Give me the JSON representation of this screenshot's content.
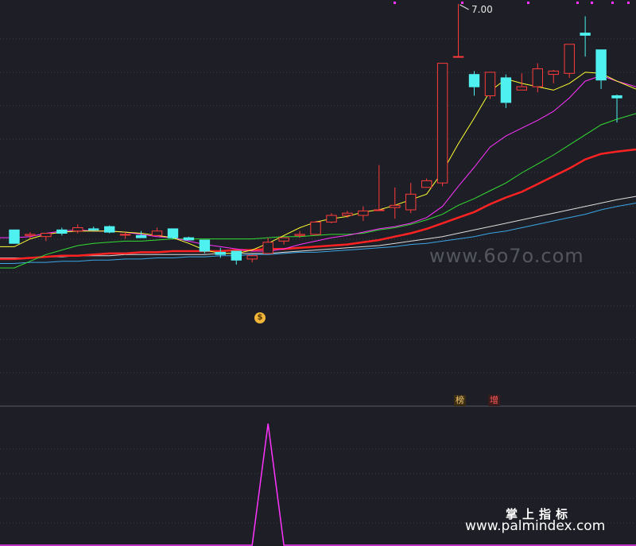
{
  "chart_data": [
    {
      "type": "candlestick",
      "title": "",
      "annotations": {
        "high_label": "7.00",
        "tags": [
          "榜",
          "增"
        ],
        "marker_icon": "moneybag-icon"
      },
      "colors": {
        "up": "#ff3b3b",
        "down": "#4ef0f0",
        "ma5": "#ffff33",
        "ma10": "#ff33ff",
        "ma20": "#33dd33",
        "ma60": "#ff2222",
        "ma120": "#dddddd",
        "ma250": "#3aa6e6",
        "grid": "#3a3f4a",
        "bg": "#1e1f26"
      },
      "ylim": [
        4.3,
        7.0
      ],
      "candles": [
        {
          "o": 4.98,
          "h": 4.98,
          "l": 4.86,
          "c": 4.86
        },
        {
          "o": 4.93,
          "h": 4.96,
          "l": 4.9,
          "c": 4.94
        },
        {
          "o": 4.92,
          "h": 4.95,
          "l": 4.88,
          "c": 4.95
        },
        {
          "o": 4.98,
          "h": 5.0,
          "l": 4.93,
          "c": 4.95
        },
        {
          "o": 4.97,
          "h": 5.03,
          "l": 4.95,
          "c": 5.0
        },
        {
          "o": 4.99,
          "h": 5.01,
          "l": 4.97,
          "c": 4.98
        },
        {
          "o": 5.01,
          "h": 5.02,
          "l": 4.95,
          "c": 4.96
        },
        {
          "o": 4.94,
          "h": 4.96,
          "l": 4.9,
          "c": 4.94
        },
        {
          "o": 4.93,
          "h": 4.97,
          "l": 4.92,
          "c": 4.91
        },
        {
          "o": 4.93,
          "h": 5.0,
          "l": 4.93,
          "c": 4.97
        },
        {
          "o": 4.99,
          "h": 4.99,
          "l": 4.9,
          "c": 4.91
        },
        {
          "o": 4.91,
          "h": 4.92,
          "l": 4.89,
          "c": 4.89
        },
        {
          "o": 4.89,
          "h": 4.89,
          "l": 4.77,
          "c": 4.79
        },
        {
          "o": 4.78,
          "h": 4.82,
          "l": 4.73,
          "c": 4.76
        },
        {
          "o": 4.79,
          "h": 4.79,
          "l": 4.67,
          "c": 4.71
        },
        {
          "o": 4.72,
          "h": 4.76,
          "l": 4.69,
          "c": 4.75
        },
        {
          "o": 4.77,
          "h": 4.91,
          "l": 4.77,
          "c": 4.87
        },
        {
          "o": 4.88,
          "h": 4.91,
          "l": 4.85,
          "c": 4.91
        },
        {
          "o": 4.93,
          "h": 4.97,
          "l": 4.91,
          "c": 4.94
        },
        {
          "o": 4.94,
          "h": 5.06,
          "l": 4.93,
          "c": 5.05
        },
        {
          "o": 5.05,
          "h": 5.13,
          "l": 5.04,
          "c": 5.11
        },
        {
          "o": 5.11,
          "h": 5.15,
          "l": 5.09,
          "c": 5.13
        },
        {
          "o": 5.11,
          "h": 5.19,
          "l": 5.06,
          "c": 5.15
        },
        {
          "o": 5.16,
          "h": 5.56,
          "l": 5.15,
          "c": 5.16
        },
        {
          "o": 5.18,
          "h": 5.36,
          "l": 5.08,
          "c": 5.2
        },
        {
          "o": 5.16,
          "h": 5.4,
          "l": 5.13,
          "c": 5.3
        },
        {
          "o": 5.36,
          "h": 5.44,
          "l": 5.36,
          "c": 5.42
        },
        {
          "o": 5.4,
          "h": 6.43,
          "l": 5.37,
          "c": 6.47
        },
        {
          "o": 6.53,
          "h": 7.0,
          "l": 6.53,
          "c": 6.53
        },
        {
          "o": 6.37,
          "h": 6.4,
          "l": 6.18,
          "c": 6.26
        },
        {
          "o": 6.18,
          "h": 6.37,
          "l": 6.15,
          "c": 6.39
        },
        {
          "o": 6.34,
          "h": 6.37,
          "l": 6.07,
          "c": 6.12
        },
        {
          "o": 6.23,
          "h": 6.38,
          "l": 6.23,
          "c": 6.26
        },
        {
          "o": 6.26,
          "h": 6.47,
          "l": 6.21,
          "c": 6.42
        },
        {
          "o": 6.37,
          "h": 6.41,
          "l": 6.29,
          "c": 6.4
        },
        {
          "o": 6.38,
          "h": 6.59,
          "l": 6.34,
          "c": 6.64
        },
        {
          "o": 6.74,
          "h": 6.89,
          "l": 6.53,
          "c": 6.72
        },
        {
          "o": 6.59,
          "h": 6.51,
          "l": 6.24,
          "c": 6.32
        },
        {
          "o": 6.18,
          "h": 6.19,
          "l": 5.94,
          "c": 6.16
        }
      ],
      "ma5": [
        4.83,
        4.9,
        4.94,
        4.96,
        4.97,
        4.97,
        4.97,
        4.96,
        4.95,
        4.93,
        4.91,
        4.86,
        4.8,
        4.77,
        4.77,
        4.8,
        4.86,
        4.93,
        5.0,
        5.05,
        5.08,
        5.1,
        5.14,
        5.16,
        5.2,
        5.25,
        5.3,
        5.5,
        5.75,
        5.98,
        6.22,
        6.33,
        6.29,
        6.26,
        6.23,
        6.29,
        6.39,
        6.38,
        6.31
      ],
      "ma10": [
        4.91,
        4.92,
        4.95,
        4.97,
        4.98,
        4.97,
        4.97,
        4.96,
        4.94,
        4.92,
        4.91,
        4.88,
        4.85,
        4.83,
        4.81,
        4.79,
        4.79,
        4.81,
        4.85,
        4.88,
        4.91,
        4.93,
        4.96,
        4.99,
        5.01,
        5.04,
        5.09,
        5.19,
        5.37,
        5.54,
        5.72,
        5.82,
        5.89,
        5.96,
        6.04,
        6.16,
        6.31,
        6.36,
        6.31
      ],
      "ma20": [
        4.64,
        4.7,
        4.76,
        4.8,
        4.84,
        4.86,
        4.87,
        4.88,
        4.88,
        4.89,
        4.9,
        4.9,
        4.9,
        4.9,
        4.9,
        4.9,
        4.91,
        4.92,
        4.92,
        4.93,
        4.94,
        4.94,
        4.95,
        4.98,
        5.0,
        5.03,
        5.07,
        5.12,
        5.2,
        5.26,
        5.33,
        5.4,
        5.49,
        5.57,
        5.65,
        5.74,
        5.83,
        5.92,
        5.97
      ],
      "ma60": [
        4.72,
        4.73,
        4.74,
        4.75,
        4.75,
        4.76,
        4.77,
        4.77,
        4.78,
        4.78,
        4.79,
        4.79,
        4.79,
        4.79,
        4.8,
        4.8,
        4.81,
        4.81,
        4.82,
        4.83,
        4.84,
        4.85,
        4.87,
        4.89,
        4.92,
        4.95,
        4.99,
        5.04,
        5.09,
        5.14,
        5.21,
        5.27,
        5.32,
        5.39,
        5.46,
        5.53,
        5.61,
        5.66,
        5.68
      ],
      "ma120": [
        4.73,
        4.73,
        4.74,
        4.74,
        4.75,
        4.75,
        4.75,
        4.76,
        4.76,
        4.76,
        4.76,
        4.76,
        4.76,
        4.77,
        4.77,
        4.77,
        4.77,
        4.78,
        4.79,
        4.8,
        4.81,
        4.82,
        4.83,
        4.84,
        4.86,
        4.88,
        4.9,
        4.92,
        4.95,
        4.98,
        5.01,
        5.04,
        5.07,
        5.1,
        5.13,
        5.16,
        5.19,
        5.22,
        5.25
      ],
      "ma250": [
        4.68,
        4.69,
        4.69,
        4.7,
        4.7,
        4.71,
        4.71,
        4.72,
        4.72,
        4.73,
        4.73,
        4.74,
        4.74,
        4.75,
        4.75,
        4.76,
        4.76,
        4.77,
        4.78,
        4.78,
        4.79,
        4.8,
        4.81,
        4.82,
        4.83,
        4.85,
        4.86,
        4.88,
        4.9,
        4.92,
        4.95,
        4.97,
        5.0,
        5.03,
        5.06,
        5.09,
        5.12,
        5.16,
        5.19
      ]
    },
    {
      "type": "line",
      "title": "",
      "series": [
        {
          "values": [
            0,
            0,
            0,
            0,
            0,
            0,
            0,
            0,
            0,
            0,
            0,
            0,
            0,
            0,
            0,
            0,
            1,
            0,
            0,
            0,
            0,
            0,
            0,
            0,
            0,
            0,
            0,
            0,
            0,
            0,
            0,
            0,
            0,
            0,
            0,
            0,
            0,
            0,
            0
          ]
        }
      ],
      "ylim": [
        0,
        1
      ],
      "colors": {
        "line": "#ff33ff"
      }
    }
  ],
  "watermarks": {
    "site": "www.6o7o.com",
    "brand": "掌上指标",
    "url": "www.palmindex.com"
  }
}
